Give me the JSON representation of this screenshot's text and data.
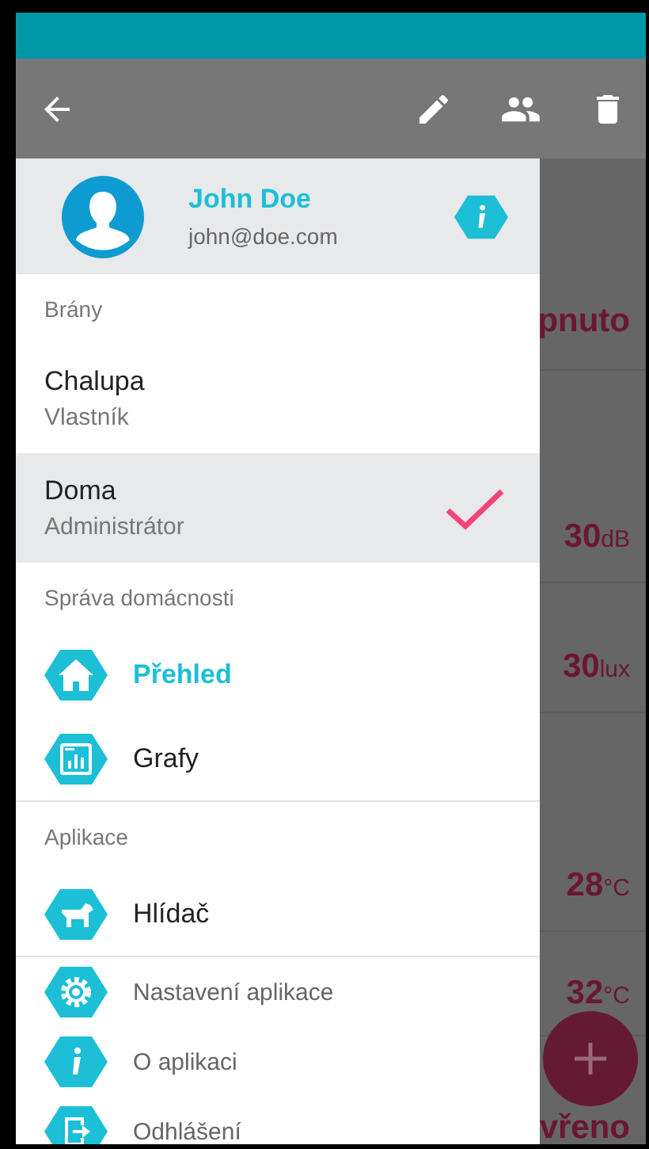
{
  "background": {
    "readings": [
      {
        "value": "pnuto"
      },
      {
        "value": "30",
        "unit": "dB"
      },
      {
        "value": "30",
        "unit": "lux"
      },
      {
        "value": "28",
        "unit": "°C"
      },
      {
        "value": "32",
        "unit": "°C"
      },
      {
        "value": "vřeno"
      }
    ]
  },
  "drawer": {
    "account": {
      "name": "John Doe",
      "email": "john@doe.com"
    },
    "sections": [
      {
        "title": "Brány",
        "items": [
          {
            "kind": "gateway",
            "label": "Chalupa",
            "role": "Vlastník",
            "selected": false
          },
          {
            "kind": "gateway",
            "label": "Doma",
            "role": "Administrátor",
            "selected": true
          }
        ]
      },
      {
        "title": "Správa domácnosti",
        "items": [
          {
            "kind": "nav",
            "label": "Přehled",
            "selected": true
          },
          {
            "kind": "nav",
            "label": "Grafy",
            "selected": false
          }
        ]
      },
      {
        "title": "Aplikace",
        "items": [
          {
            "kind": "nav",
            "label": "Hlídač",
            "selected": false
          }
        ]
      },
      {
        "items": [
          {
            "kind": "action",
            "label": "Nastavení aplikace"
          },
          {
            "kind": "action",
            "label": "O aplikaci"
          },
          {
            "kind": "action",
            "label": "Odhlášení"
          }
        ]
      }
    ]
  }
}
